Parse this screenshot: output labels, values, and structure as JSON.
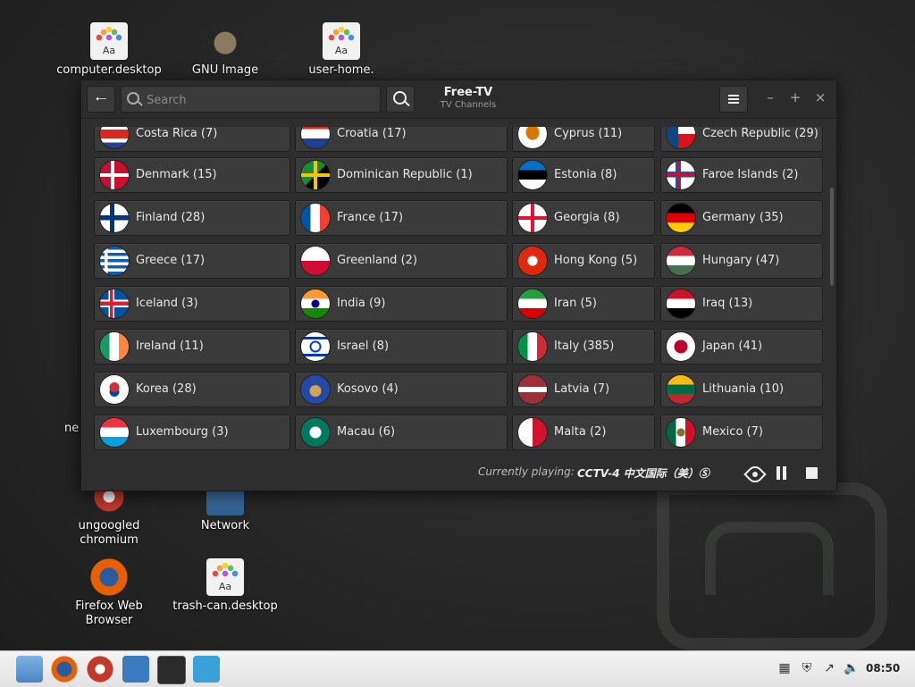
{
  "desktop": {
    "icons": [
      {
        "label": "computer.desktop"
      },
      {
        "label": "GNU Image"
      },
      {
        "label": "user-home."
      },
      {
        "label": "ungoogled chromium"
      },
      {
        "label": "Network"
      },
      {
        "label": "Firefox Web Browser"
      },
      {
        "label": "trash-can.desktop"
      },
      {
        "label": "ne"
      }
    ]
  },
  "window": {
    "title": "Free-TV",
    "subtitle": "TV Channels",
    "search_placeholder": "Search",
    "back_icon": "arrow-left-icon",
    "menu_icon": "hamburger-icon",
    "controls": {
      "minimize": "–",
      "maximize": "+",
      "close": "×"
    }
  },
  "countries": [
    [
      "Costa Rica (7)",
      "Croatia (17)",
      "Cyprus (11)",
      "Czech Republic (29)"
    ],
    [
      "Denmark (15)",
      "Dominican Republic (1)",
      "Estonia (8)",
      "Faroe Islands (2)"
    ],
    [
      "Finland (28)",
      "France (17)",
      "Georgia (8)",
      "Germany (35)"
    ],
    [
      "Greece (17)",
      "Greenland (2)",
      "Hong Kong (5)",
      "Hungary (47)"
    ],
    [
      "Iceland (3)",
      "India (9)",
      "Iran (5)",
      "Iraq (13)"
    ],
    [
      "Ireland (11)",
      "Israel (8)",
      "Italy (385)",
      "Japan (41)"
    ],
    [
      "Korea (28)",
      "Kosovo (4)",
      "Latvia (7)",
      "Lithuania (10)"
    ],
    [
      "Luxembourg (3)",
      "Macau (6)",
      "Malta (2)",
      "Mexico (7)"
    ]
  ],
  "status": {
    "label": "Currently playing:",
    "channel": "CCTV-4 中文国际（美）Ⓢ"
  },
  "taskbar": {
    "apps": [
      "folder-icon",
      "firefox-icon",
      "chromium-icon",
      "system-monitor-icon",
      "terminal-icon",
      "freetv-icon"
    ],
    "clock": "08:50"
  }
}
